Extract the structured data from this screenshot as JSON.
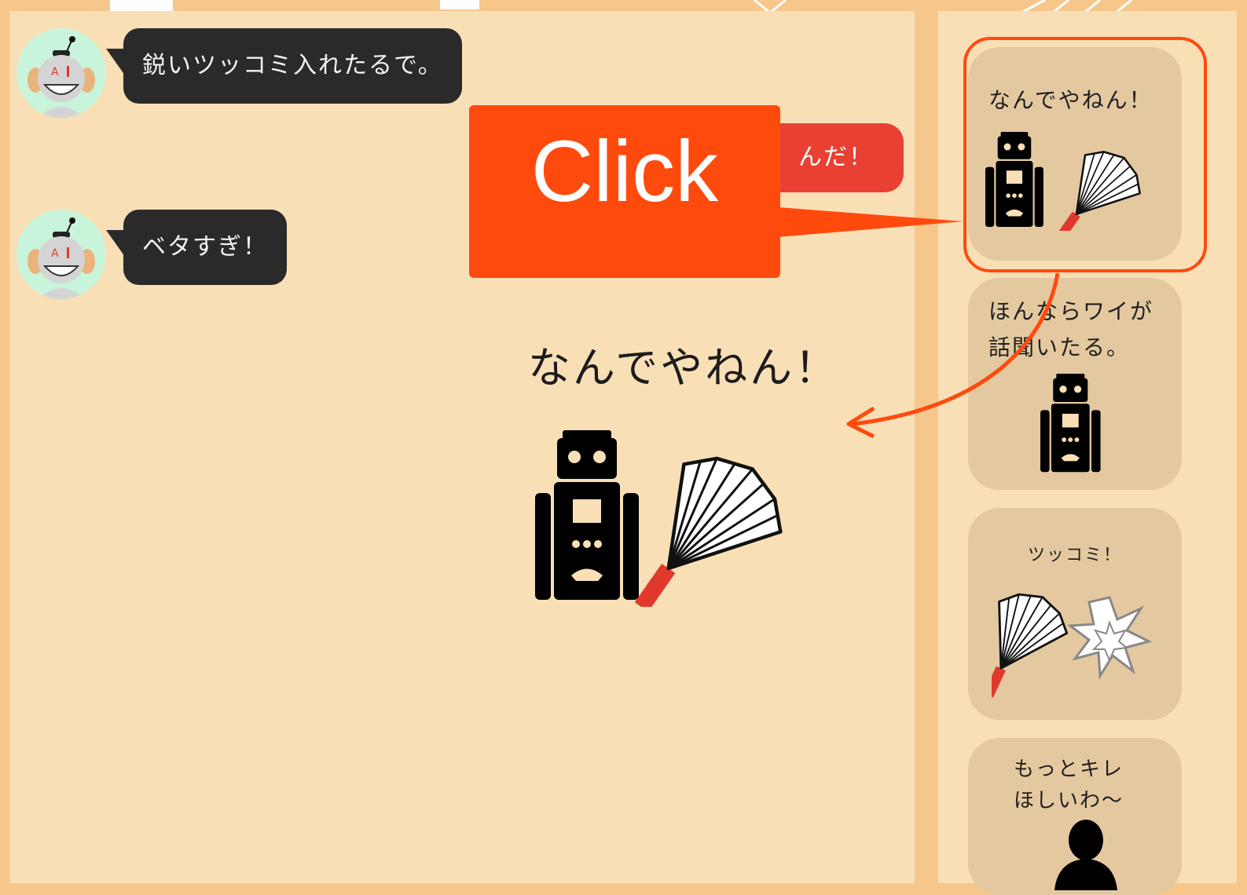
{
  "chat": {
    "messages": [
      {
        "sender": "bot",
        "text": "鋭いツッコミ入れたるで。"
      },
      {
        "sender": "user",
        "text": "んだ！"
      },
      {
        "sender": "bot",
        "text": "ベタすぎ！"
      }
    ]
  },
  "preview": {
    "title": "なんでやねん！"
  },
  "stamps": [
    {
      "text": "なんでやねん！",
      "image": "robot-with-harisen"
    },
    {
      "text": "ほんならワイが\n話聞いたる。",
      "image": "robot"
    },
    {
      "text": "ツッコミ！",
      "image": "harisen-with-burst"
    },
    {
      "text": "もっとキレ\nほしいわ〜",
      "image": "person-silhouette"
    }
  ],
  "annotation": {
    "callout_label": "Click",
    "color": "#ff4a0d"
  },
  "colors": {
    "background": "#f6c68a",
    "panel": "#f8dfb6",
    "bot_bubble": "#2a2a2a",
    "user_bubble": "#e84134",
    "stamp_card": "#e4c9a0",
    "avatar_bg": "#c9f4dc"
  }
}
